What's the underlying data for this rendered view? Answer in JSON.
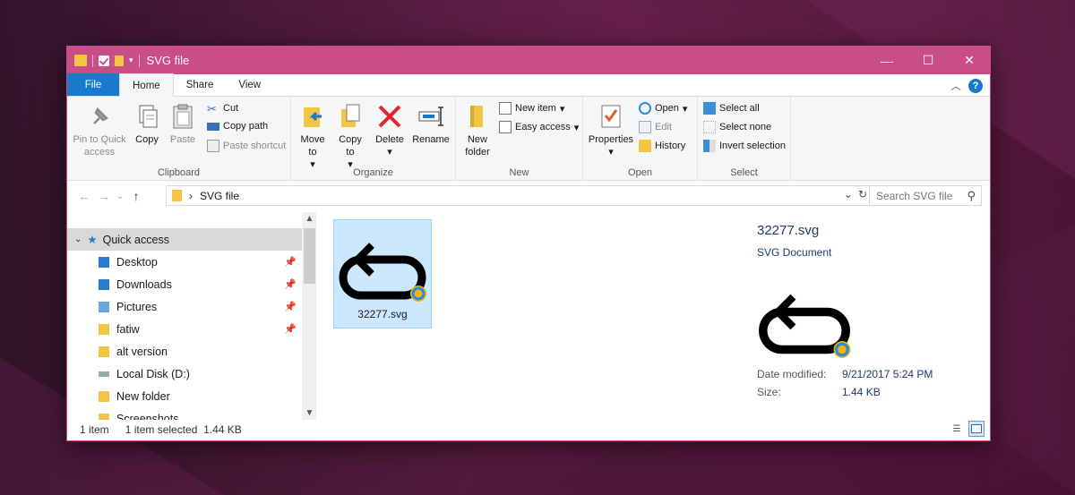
{
  "window": {
    "title": "SVG file",
    "controls": {
      "minimize": "—",
      "maximize": "☐",
      "close": "✕"
    }
  },
  "ribbon_tabs": [
    "File",
    "Home",
    "Share",
    "View"
  ],
  "ribbon": {
    "clipboard": {
      "label": "Clipboard",
      "pin_to_quick_access": "Pin to Quick access",
      "copy": "Copy",
      "paste": "Paste",
      "cut": "Cut",
      "copy_path": "Copy path",
      "paste_shortcut": "Paste shortcut"
    },
    "organize": {
      "label": "Organize",
      "move_to": "Move to",
      "copy_to": "Copy to",
      "delete": "Delete",
      "rename": "Rename"
    },
    "new": {
      "label": "New",
      "new_folder": "New folder",
      "new_item": "New item",
      "easy_access": "Easy access"
    },
    "open": {
      "label": "Open",
      "properties": "Properties",
      "open": "Open",
      "edit": "Edit",
      "history": "History"
    },
    "select": {
      "label": "Select",
      "select_all": "Select all",
      "select_none": "Select none",
      "invert_selection": "Invert selection"
    }
  },
  "address": {
    "path": "SVG file",
    "search_placeholder": "Search SVG file"
  },
  "nav_pane": {
    "quick_access": "Quick access",
    "items": [
      {
        "label": "Desktop",
        "pinned": true
      },
      {
        "label": "Downloads",
        "pinned": true
      },
      {
        "label": "Pictures",
        "pinned": true
      },
      {
        "label": "fatiw",
        "pinned": true
      },
      {
        "label": "alt version",
        "pinned": false
      },
      {
        "label": "Local Disk (D:)",
        "pinned": false
      },
      {
        "label": "New folder",
        "pinned": false
      },
      {
        "label": "Screenshots",
        "pinned": false
      }
    ]
  },
  "files": [
    {
      "name": "32277.svg"
    }
  ],
  "preview": {
    "filename": "32277.svg",
    "type": "SVG Document",
    "date_modified_label": "Date modified:",
    "date_modified": "9/21/2017 5:24 PM",
    "size_label": "Size:",
    "size": "1.44 KB"
  },
  "status": {
    "count": "1 item",
    "selected": "1 item selected  1.44 KB"
  },
  "colors": {
    "accent": "#c94d86",
    "file_tab": "#1979ca",
    "selection": "#cce8ff"
  }
}
